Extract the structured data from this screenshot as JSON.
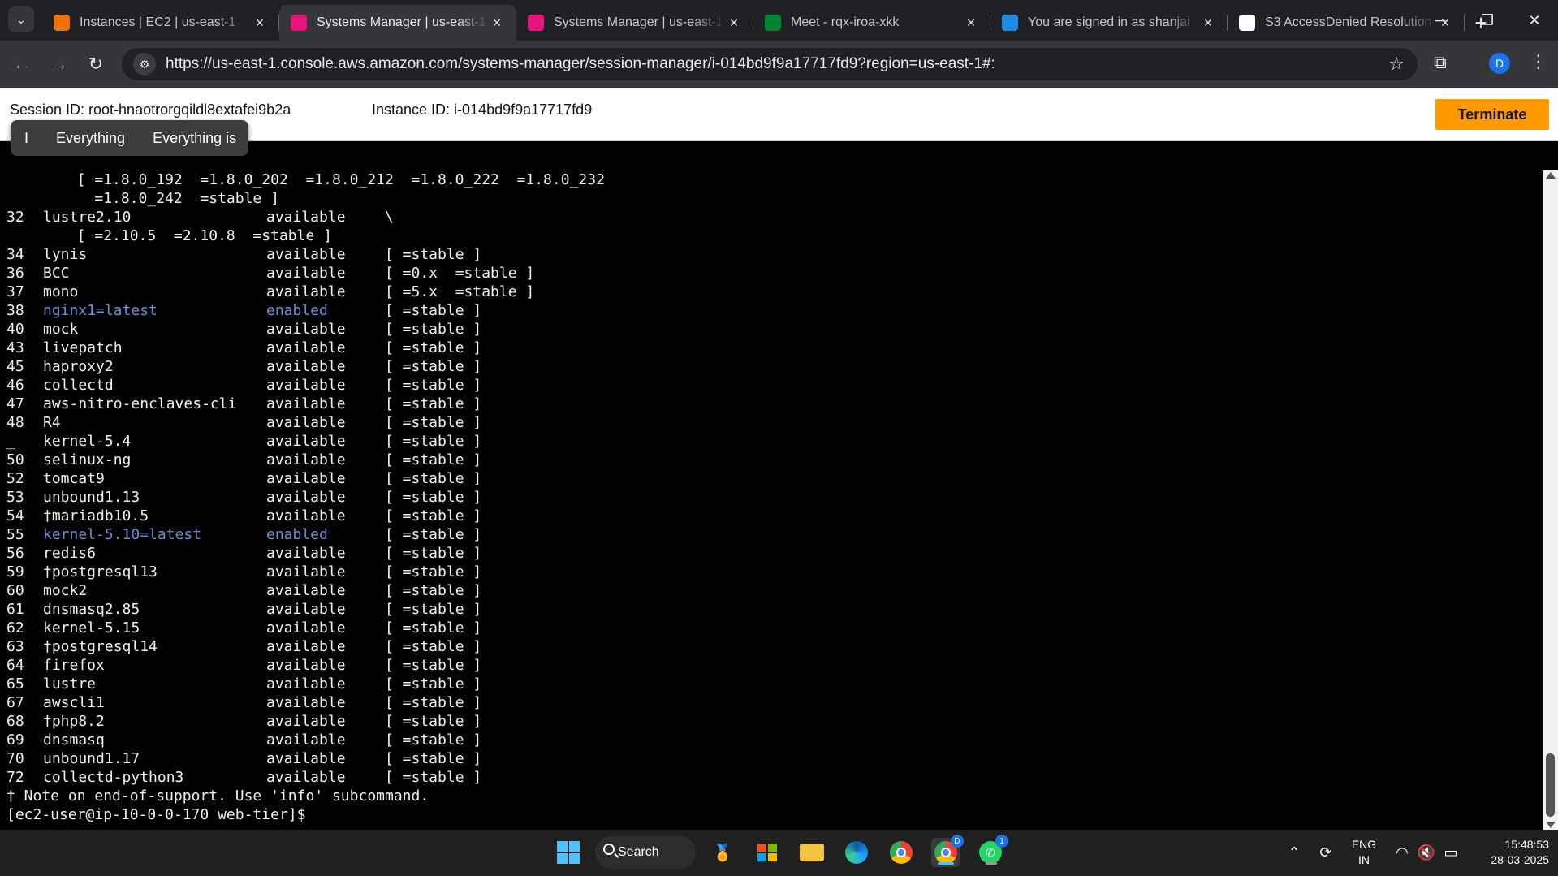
{
  "browser": {
    "tabs": [
      {
        "title": "Instances | EC2 | us-east-1",
        "icon": "aws-ec2-icon",
        "color": "#ed7100"
      },
      {
        "title": "Systems Manager | us-east-1",
        "icon": "aws-ssm-icon",
        "color": "#e7157b",
        "active": true
      },
      {
        "title": "Systems Manager | us-east-1",
        "icon": "aws-ssm-icon",
        "color": "#e7157b"
      },
      {
        "title": "Meet - rqx-iroa-xkk",
        "icon": "google-meet-icon",
        "color": "#00832d"
      },
      {
        "title": "You are signed in as shanjai",
        "icon": "s-icon",
        "color": "#1e88e5"
      },
      {
        "title": "S3 AccessDenied Resolution",
        "icon": "openai-icon",
        "color": "#ffffff"
      }
    ],
    "url": "https://us-east-1.console.aws.amazon.com/systems-manager/session-manager/i-014bd9f9a17717fd9?region=us-east-1#:",
    "profile_initial": "D"
  },
  "session": {
    "session_id_label": "Session ID: root-hnaotrorgqildl8extafei9b2a",
    "instance_id_label": "Instance ID: i-014bd9f9a17717fd9",
    "terminate_label": "Terminate"
  },
  "suggestions": [
    "I",
    "Everything",
    "Everything is"
  ],
  "terminal": {
    "continuation_lines": [
      "        [ =1.8.0_192  =1.8.0_202  =1.8.0_212  =1.8.0_222  =1.8.0_232",
      "          =1.8.0_242  =stable ]"
    ],
    "rows": [
      {
        "num": "32",
        "name": "lustre2.10",
        "status": "available",
        "channels": "\\"
      },
      {
        "cont": "        [ =2.10.5  =2.10.8  =stable ]"
      },
      {
        "num": "34",
        "name": "lynis",
        "status": "available",
        "channels": "[ =stable ]"
      },
      {
        "num": "36",
        "name": "BCC",
        "status": "available",
        "channels": "[ =0.x  =stable ]"
      },
      {
        "num": "37",
        "name": "mono",
        "status": "available",
        "channels": "[ =5.x  =stable ]"
      },
      {
        "num": "38",
        "name": "nginx1=latest",
        "status": "enabled",
        "channels": "[ =stable ]",
        "highlight": true
      },
      {
        "num": "40",
        "name": "mock",
        "status": "available",
        "channels": "[ =stable ]"
      },
      {
        "num": "43",
        "name": "livepatch",
        "status": "available",
        "channels": "[ =stable ]"
      },
      {
        "num": "45",
        "name": "haproxy2",
        "status": "available",
        "channels": "[ =stable ]"
      },
      {
        "num": "46",
        "name": "collectd",
        "status": "available",
        "channels": "[ =stable ]"
      },
      {
        "num": "47",
        "name": "aws-nitro-enclaves-cli",
        "status": "available",
        "channels": "[ =stable ]"
      },
      {
        "num": "48",
        "name": "R4",
        "status": "available",
        "channels": "[ =stable ]"
      },
      {
        "num": "_",
        "name": "kernel-5.4",
        "status": "available",
        "channels": "[ =stable ]"
      },
      {
        "num": "50",
        "name": "selinux-ng",
        "status": "available",
        "channels": "[ =stable ]"
      },
      {
        "num": "52",
        "name": "tomcat9",
        "status": "available",
        "channels": "[ =stable ]"
      },
      {
        "num": "53",
        "name": "unbound1.13",
        "status": "available",
        "channels": "[ =stable ]"
      },
      {
        "num": "54",
        "name": "†mariadb10.5",
        "status": "available",
        "channels": "[ =stable ]"
      },
      {
        "num": "55",
        "name": "kernel-5.10=latest",
        "status": "enabled",
        "channels": "[ =stable ]",
        "highlight": true
      },
      {
        "num": "56",
        "name": "redis6",
        "status": "available",
        "channels": "[ =stable ]"
      },
      {
        "num": "59",
        "name": "†postgresql13",
        "status": "available",
        "channels": "[ =stable ]"
      },
      {
        "num": "60",
        "name": "mock2",
        "status": "available",
        "channels": "[ =stable ]"
      },
      {
        "num": "61",
        "name": "dnsmasq2.85",
        "status": "available",
        "channels": "[ =stable ]"
      },
      {
        "num": "62",
        "name": "kernel-5.15",
        "status": "available",
        "channels": "[ =stable ]"
      },
      {
        "num": "63",
        "name": "†postgresql14",
        "status": "available",
        "channels": "[ =stable ]"
      },
      {
        "num": "64",
        "name": "firefox",
        "status": "available",
        "channels": "[ =stable ]"
      },
      {
        "num": "65",
        "name": "lustre",
        "status": "available",
        "channels": "[ =stable ]"
      },
      {
        "num": "67",
        "name": "awscli1",
        "status": "available",
        "channels": "[ =stable ]"
      },
      {
        "num": "68",
        "name": "†php8.2",
        "status": "available",
        "channels": "[ =stable ]"
      },
      {
        "num": "69",
        "name": "dnsmasq",
        "status": "available",
        "channels": "[ =stable ]"
      },
      {
        "num": "70",
        "name": "unbound1.17",
        "status": "available",
        "channels": "[ =stable ]"
      },
      {
        "num": "72",
        "name": "collectd-python3",
        "status": "available",
        "channels": "[ =stable ]"
      }
    ],
    "note": "† Note on end-of-support. Use 'info' subcommand.",
    "prompt": "[ec2-user@ip-10-0-0-170 web-tier]$"
  },
  "taskbar": {
    "search_label": "Search",
    "lang_line1": "ENG",
    "lang_line2": "IN",
    "time": "15:48:53",
    "date": "28-03-2025",
    "chrome_badge": "D",
    "whatsapp_badge": "1"
  }
}
